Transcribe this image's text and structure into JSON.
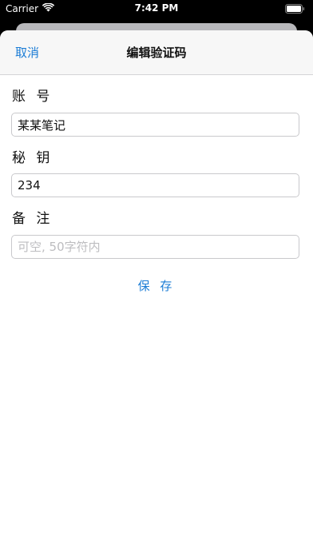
{
  "status_bar": {
    "carrier": "Carrier",
    "time": "7:42 PM",
    "wifi_icon": "wifi-icon",
    "battery_icon": "battery-icon"
  },
  "nav": {
    "cancel_label": "取消",
    "title": "编辑验证码"
  },
  "form": {
    "account": {
      "label": "账 号",
      "value": "某某笔记"
    },
    "secret": {
      "label": "秘 钥",
      "value": "234"
    },
    "note": {
      "label": "备 注",
      "value": "",
      "placeholder": "可空, 50字符内"
    }
  },
  "save_label": "保 存",
  "colors": {
    "accent": "#1b7cd5",
    "nav_background": "#f7f7f7",
    "border": "#c9c9cc",
    "placeholder": "#bdbdc0"
  }
}
